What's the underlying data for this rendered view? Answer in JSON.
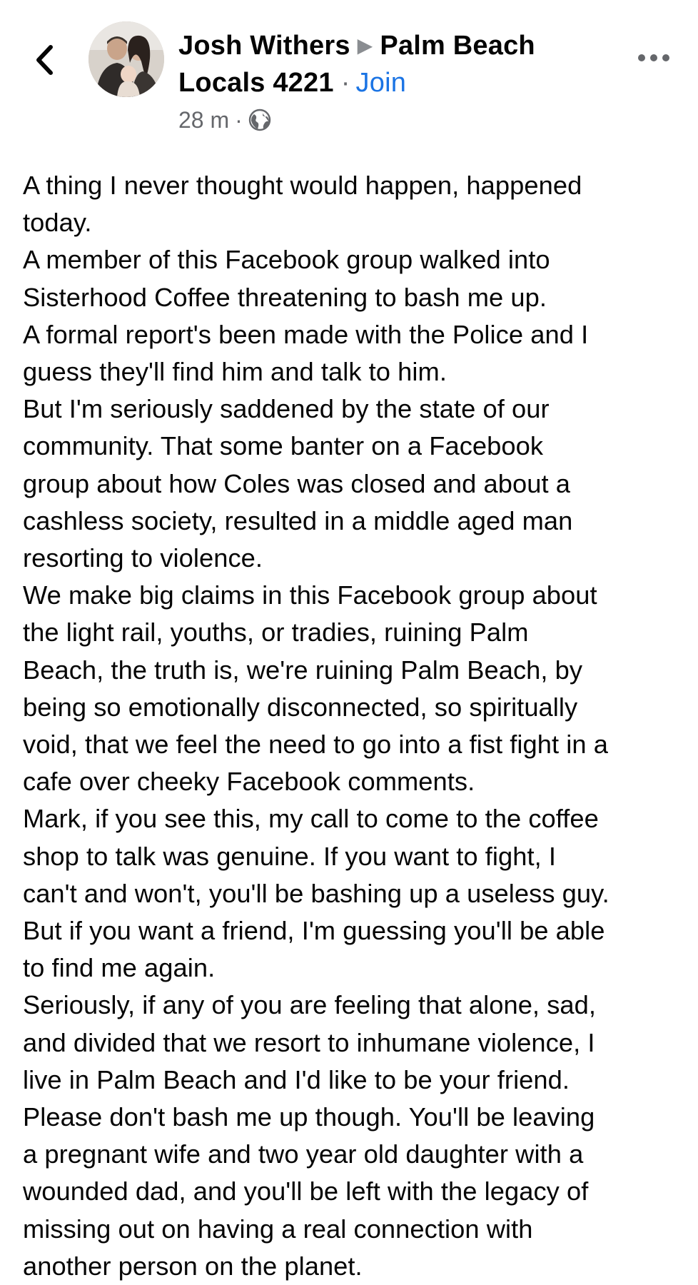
{
  "header": {
    "author": "Josh Withers",
    "group_line1": "Palm Beach",
    "group_line2": "Locals 4221",
    "join_label": "Join",
    "timestamp": "28 m",
    "back_icon": "chevron-left-icon",
    "privacy_icon": "globe-icon",
    "more_icon": "more-horizontal-icon"
  },
  "post": {
    "lines": [
      "A thing I never thought would happen, happened",
      "today.",
      "A member of this Facebook group walked into",
      "Sisterhood Coffee threatening to bash me up.",
      "A formal report's been made with the Police and I",
      "guess they'll find him and talk to him.",
      "But I'm seriously saddened by the state of our",
      "community. That some banter on a Facebook",
      "group about how Coles was closed and about a",
      "cashless society, resulted in a middle aged man",
      "resorting to violence.",
      "We make big claims in this Facebook group about",
      "the light rail, youths, or tradies, ruining Palm",
      "Beach, the truth is, we're ruining Palm Beach, by",
      "being so emotionally disconnected, so spiritually",
      "void, that we feel the need to go into a fist fight in a",
      "cafe over cheeky Facebook comments.",
      "Mark, if you see this, my call to come to the coffee",
      "shop to talk was genuine. If you want to fight, I",
      "can't and won't, you'll be bashing up a useless guy.",
      "But if you want a friend, I'm guessing you'll be able",
      "to find me again.",
      "Seriously, if any of you are feeling that alone, sad,",
      "and divided that we resort to inhumane violence, I",
      "live in Palm Beach and I'd like to be your friend.",
      "Please don't bash me up though. You'll be leaving",
      "a pregnant wife and two year old daughter with a",
      "wounded dad, and you'll be left with the legacy of",
      "missing out on having a real connection with",
      "another person on the planet."
    ]
  },
  "colors": {
    "link": "#1b74e4",
    "secondary_text": "#65676b",
    "primary_text": "#050505",
    "background": "#ffffff"
  }
}
